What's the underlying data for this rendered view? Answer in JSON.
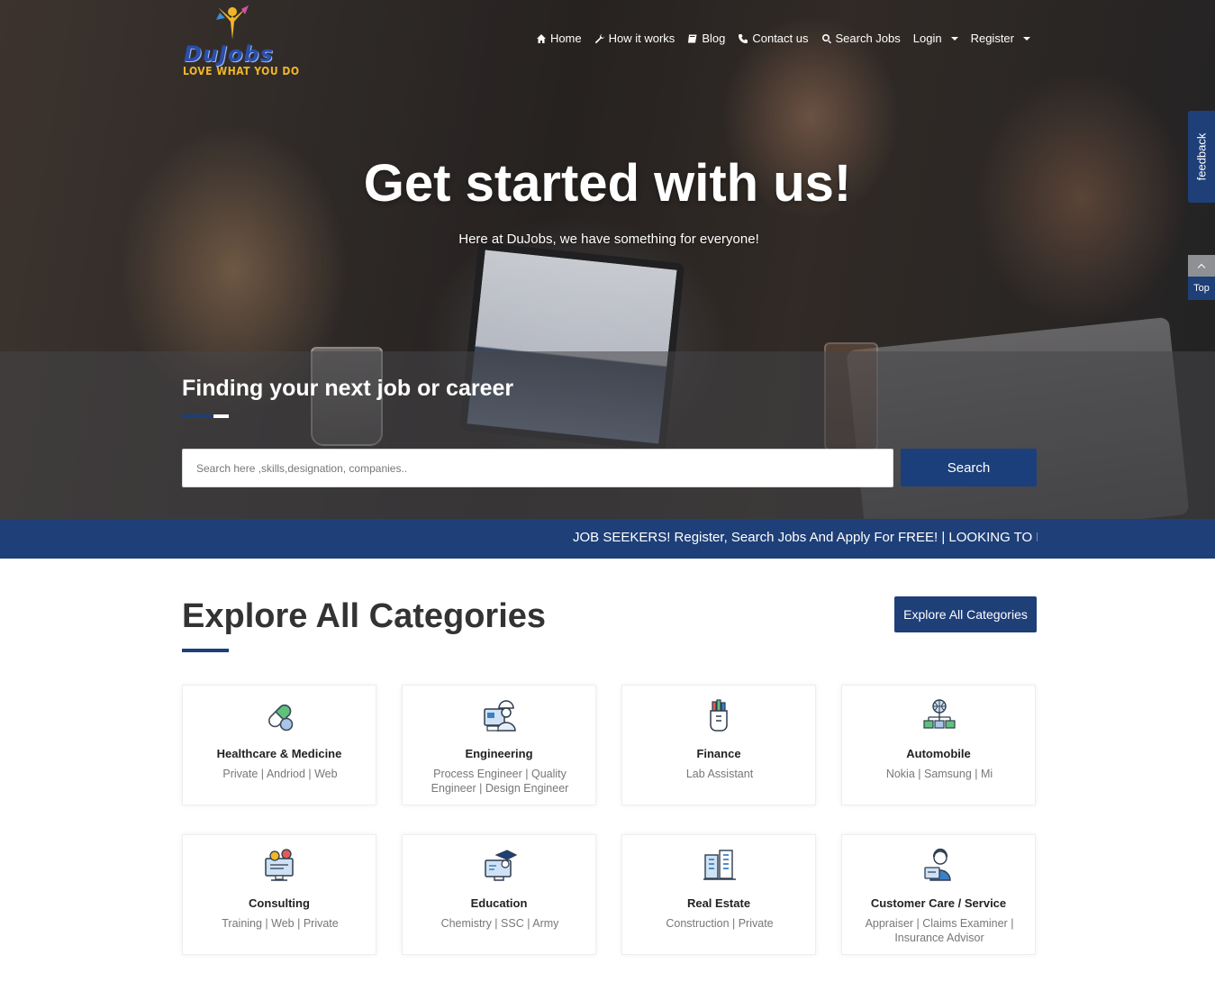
{
  "brand": {
    "logo_name": "DuJobs",
    "logo_tagline": "LOVE WHAT YOU DO"
  },
  "nav": {
    "items": [
      {
        "label": "Home",
        "icon": "home-icon"
      },
      {
        "label": "How it works",
        "icon": "wrench-icon"
      },
      {
        "label": "Blog",
        "icon": "book-icon"
      },
      {
        "label": "Contact us",
        "icon": "phone-icon"
      },
      {
        "label": "Search Jobs",
        "icon": "search-icon"
      },
      {
        "label": "Login",
        "icon": "chevron-down-icon"
      },
      {
        "label": "Register",
        "icon": "chevron-down-icon"
      }
    ]
  },
  "hero": {
    "title": "Get started with us!",
    "subtitle": "Here at DuJobs, we have something for everyone!"
  },
  "search": {
    "heading": "Finding your next job or career",
    "placeholder": "Search here ,skills,designation, companies..",
    "button": "Search"
  },
  "ticker": {
    "text": "JOB SEEKERS! Register, Search Jobs And Apply For FREE!  |  LOOKING TO RELOCATE"
  },
  "side": {
    "feedback": "feedback",
    "top": "Top"
  },
  "categories": {
    "title": "Explore All Categories",
    "button": "Explore All Categories",
    "items": [
      {
        "title": "Healthcare & Medicine",
        "sub": "Private | Andriod | Web",
        "icon": "pill-icon"
      },
      {
        "title": "Engineering",
        "sub": "Process Engineer | Quality Engineer | Design Engineer",
        "icon": "engineer-icon"
      },
      {
        "title": "Finance",
        "sub": "Lab Assistant",
        "icon": "finance-icon"
      },
      {
        "title": "Automobile",
        "sub": "Nokia | Samsung | Mi",
        "icon": "network-icon"
      },
      {
        "title": "Consulting",
        "sub": "Training | Web | Private",
        "icon": "monitor-gears-icon"
      },
      {
        "title": "Education",
        "sub": "Chemistry | SSC | Army",
        "icon": "graduation-icon"
      },
      {
        "title": "Real Estate",
        "sub": "Construction | Private",
        "icon": "building-icon"
      },
      {
        "title": "Customer Care / Service",
        "sub": "Appraiser | Claims Examiner | Insurance Advisor",
        "icon": "agent-icon"
      }
    ]
  },
  "colors": {
    "primary": "#1e3f78",
    "accent_underline": "#1b3f7a",
    "white": "#ffffff"
  }
}
